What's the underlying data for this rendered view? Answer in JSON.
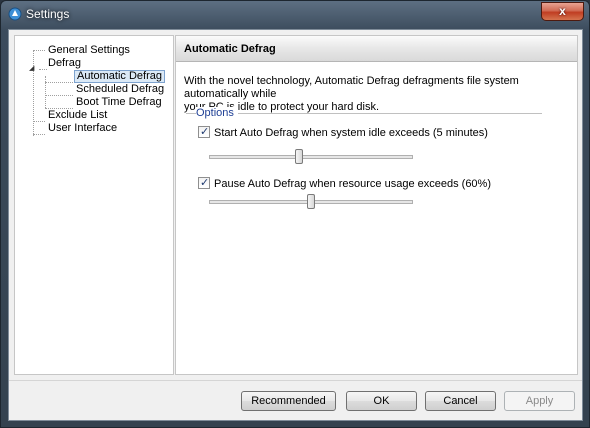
{
  "window": {
    "title": "Settings",
    "close_label": "x"
  },
  "tree": {
    "items": [
      {
        "label": "General Settings"
      },
      {
        "label": "Defrag",
        "expander": "◢"
      },
      {
        "label": "Automatic Defrag"
      },
      {
        "label": "Scheduled Defrag"
      },
      {
        "label": "Boot Time Defrag"
      },
      {
        "label": "Exclude List"
      },
      {
        "label": "User Interface"
      }
    ]
  },
  "panel": {
    "title": "Automatic Defrag",
    "description_line1": "With the novel technology, Automatic Defrag defragments file system automatically while",
    "description_line2": "your PC is idle to protect your hard disk.",
    "group_label": "Options",
    "option1": {
      "label": "Start Auto Defrag when system idle exceeds (5 minutes)",
      "checked_mark": "✓",
      "slider_fraction": 0.44
    },
    "option2": {
      "label": "Pause Auto Defrag when resource usage exceeds (60%)",
      "checked_mark": "✓",
      "slider_fraction": 0.5
    }
  },
  "buttons": {
    "recommended": "Recommended",
    "ok": "OK",
    "cancel": "Cancel",
    "apply": "Apply"
  },
  "colors": {
    "selection_bg": "#dbe9f6",
    "selection_border": "#7da2ce",
    "group_label": "#1e3f95",
    "close_red": "#c03d22"
  }
}
